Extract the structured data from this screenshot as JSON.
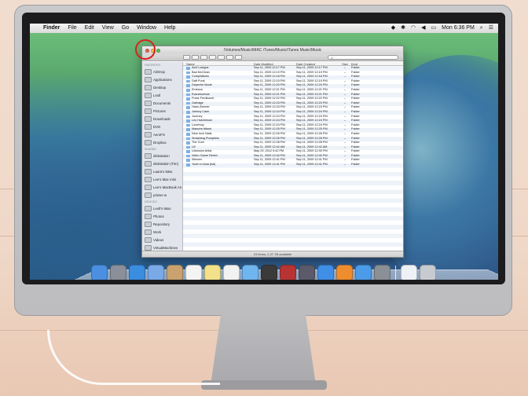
{
  "menubar": {
    "apple": "",
    "items": [
      "Finder",
      "File",
      "Edit",
      "View",
      "Go",
      "Window",
      "Help"
    ],
    "clock": "Mon 6:36 PM"
  },
  "finder": {
    "title": "/Volumes/Music/iMAC iTunes/Music/iTunes Music/Music",
    "search_placeholder": "Q",
    "columns": {
      "name": "Name",
      "modified": "Date Modified",
      "created": "Date Created",
      "size": "Size",
      "kind": "Kind"
    },
    "sidebar": {
      "favorites_header": "FAVORITES",
      "favorites": [
        "AirDrop",
        "Applications",
        "Desktop",
        "Leoll",
        "Documents",
        "Pictures",
        "Downloads",
        "DVD",
        "AeroFS",
        "Dropbox"
      ],
      "shared_header": "SHARED",
      "shared": [
        "diskstation",
        "diskstation (Tim)",
        "Laura's iMac",
        "Lee's Mac mini",
        "Lee's MacBook Air",
        "printer-w"
      ],
      "devices_header": "DEVICES",
      "devices": [
        "Leoll's iMac",
        "Photos",
        "Repository",
        "Work",
        "Videos",
        "VirtualMachines"
      ]
    },
    "rows": [
      [
        "Avril Lavigne",
        "Sep 11, 2009 12:17 PM",
        "Sep 11, 2009 12:17 PM",
        "--",
        "Folder"
      ],
      [
        "Bad McClean",
        "Sep 11, 2009 12:19 PM",
        "Sep 11, 2009 12:19 PM",
        "--",
        "Folder"
      ],
      [
        "Compilations",
        "Sep 11, 2009 12:18 PM",
        "Sep 11, 2009 12:18 PM",
        "--",
        "Folder"
      ],
      [
        "Daft Punk",
        "Sep 11, 2009 12:19 PM",
        "Sep 11, 2009 12:19 PM",
        "--",
        "Folder"
      ],
      [
        "Depeche Mode",
        "Sep 11, 2009 12:20 PM",
        "Sep 11, 2009 12:20 PM",
        "--",
        "Folder"
      ],
      [
        "Eminem",
        "Sep 11, 2009 12:21 PM",
        "Sep 11, 2009 12:21 PM",
        "--",
        "Folder"
      ],
      [
        "Evanescence",
        "Sep 11, 2009 12:21 PM",
        "Sep 11, 2009 12:21 PM",
        "--",
        "Folder"
      ],
      [
        "Franz Ferdinand",
        "Sep 11, 2009 12:22 PM",
        "Sep 11, 2009 12:22 PM",
        "--",
        "Folder"
      ],
      [
        "Garbage",
        "Sep 11, 2009 12:23 PM",
        "Sep 11, 2009 12:23 PM",
        "--",
        "Folder"
      ],
      [
        "Hans Zimmer",
        "Sep 11, 2009 12:23 PM",
        "Sep 11, 2009 12:23 PM",
        "--",
        "Folder"
      ],
      [
        "Johnny Cash",
        "Sep 11, 2009 12:24 PM",
        "Sep 11, 2009 12:24 PM",
        "--",
        "Folder"
      ],
      [
        "Journey",
        "Sep 11, 2009 12:24 PM",
        "Sep 11, 2009 12:24 PM",
        "--",
        "Folder"
      ],
      [
        "Les Hutchinson",
        "Sep 11, 2009 12:24 PM",
        "Sep 11, 2009 12:24 PM",
        "--",
        "Folder"
      ],
      [
        "Loverboy",
        "Sep 11, 2009 12:24 PM",
        "Sep 11, 2009 12:24 PM",
        "--",
        "Folder"
      ],
      [
        "Massive Attack",
        "Sep 11, 2009 12:25 PM",
        "Sep 11, 2009 12:25 PM",
        "--",
        "Folder"
      ],
      [
        "Nine Inch Nails",
        "Sep 11, 2009 12:26 PM",
        "Sep 11, 2009 12:26 PM",
        "--",
        "Folder"
      ],
      [
        "Smashing Pumpkins",
        "Sep 11, 2009 12:26 PM",
        "Sep 11, 2009 12:26 PM",
        "--",
        "Folder"
      ],
      [
        "The Cure",
        "Sep 11, 2009 12:28 PM",
        "Sep 11, 2009 12:28 PM",
        "--",
        "Folder"
      ],
      [
        "U2",
        "Sep 11, 2009 12:42 AM",
        "Sep 11, 2009 12:42 AM",
        "--",
        "Folder"
      ],
      [
        "Unknown Artist",
        "May 29, 2012 9:42 PM",
        "Sep 11, 2009 12:30 PM",
        "--",
        "Folder"
      ],
      [
        "Video Game Remix",
        "Sep 11, 2009 12:40 PM",
        "Sep 11, 2009 12:40 PM",
        "--",
        "Folder"
      ],
      [
        "Weezer",
        "Sep 11, 2009 12:41 PM",
        "Sep 11, 2009 12:41 PM",
        "--",
        "Folder"
      ],
      [
        "Youth in Asia (full)",
        "Sep 11, 2009 12:41 PM",
        "Sep 11, 2009 12:41 PM",
        "--",
        "Folder"
      ]
    ],
    "status": "23 items, 2.27 TB available"
  },
  "dock": {
    "icons": [
      {
        "name": "finder-icon",
        "color": "#4a8fe0"
      },
      {
        "name": "launchpad-icon",
        "color": "#8a8f99"
      },
      {
        "name": "safari-icon",
        "color": "#3b8de0"
      },
      {
        "name": "mail-icon",
        "color": "#7aa9e8"
      },
      {
        "name": "contacts-icon",
        "color": "#c9a270"
      },
      {
        "name": "calendar-icon",
        "color": "#f4f4f4"
      },
      {
        "name": "notes-icon",
        "color": "#f3e08a"
      },
      {
        "name": "reminders-icon",
        "color": "#f2f2f2"
      },
      {
        "name": "messages-icon",
        "color": "#6fb6f0"
      },
      {
        "name": "facetime-icon",
        "color": "#3a3a3a"
      },
      {
        "name": "photo-booth-icon",
        "color": "#b83434"
      },
      {
        "name": "iphoto-icon",
        "color": "#5a5a6a"
      },
      {
        "name": "itunes-icon",
        "color": "#3f8fe6"
      },
      {
        "name": "ibooks-icon",
        "color": "#ef8d2e"
      },
      {
        "name": "app-store-icon",
        "color": "#4b9be8"
      },
      {
        "name": "system-preferences-icon",
        "color": "#8b8f96"
      },
      {
        "name": "documents-stack-icon",
        "color": "#eef2f6"
      },
      {
        "name": "trash-icon",
        "color": "#c7cbd1"
      }
    ]
  }
}
